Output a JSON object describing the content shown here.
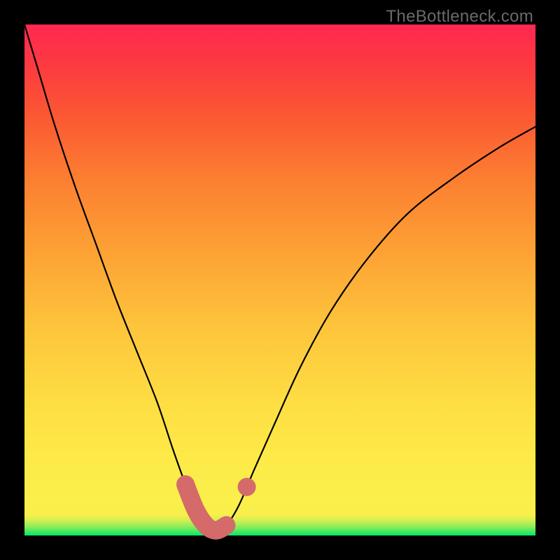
{
  "watermark": "TheBottleneck.com",
  "chart_data": {
    "type": "line",
    "title": "",
    "xlabel": "",
    "ylabel": "",
    "xlim": [
      0,
      100
    ],
    "ylim": [
      0,
      100
    ],
    "series": [
      {
        "name": "curve",
        "x": [
          0,
          3,
          6,
          10,
          14,
          18,
          22,
          26,
          29,
          31.5,
          33.5,
          35.5,
          37.5,
          39.5,
          42,
          45,
          49,
          54,
          60,
          67,
          75,
          84,
          93,
          100
        ],
        "values": [
          100,
          90,
          80,
          68,
          57,
          46,
          36,
          26,
          17,
          10,
          5,
          2,
          1,
          2,
          6,
          13,
          22,
          33,
          44,
          54,
          63,
          70,
          76,
          80
        ]
      }
    ],
    "highlight_range_x": [
      30,
      41
    ],
    "highlight_dot_x": 43.5,
    "background_gradient": {
      "top": "#fe2850",
      "mid": "#fde548",
      "bottom": "#00e765"
    },
    "curve_color": "#000000",
    "highlight_color": "#d46a6a"
  }
}
